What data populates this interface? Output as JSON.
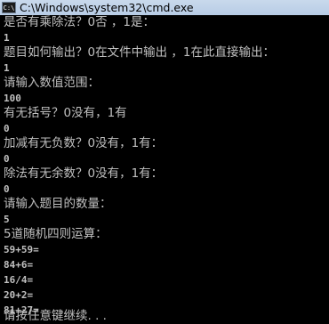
{
  "window": {
    "icon_label": "C:\\",
    "title": "C:\\Windows\\system32\\cmd.exe"
  },
  "console": {
    "lines": [
      "是否有乘除法？0否 ，1是：",
      "1",
      "题目如何输出？0在文件中输出 ，1在此直接输出：",
      "1",
      "请输入数值范围：",
      "100",
      "有无括号？0没有，1有",
      "0",
      "加减有无负数？0没有，1有：",
      "0",
      "除法有无余数？0没有，1有：",
      "0",
      "请输入题目的数量：",
      "5",
      "5道随机四则运算：",
      "59+59=",
      "84+6=",
      "16/4=",
      "20+2=",
      "81+27=",
      "请按任意键继续. . ."
    ]
  }
}
